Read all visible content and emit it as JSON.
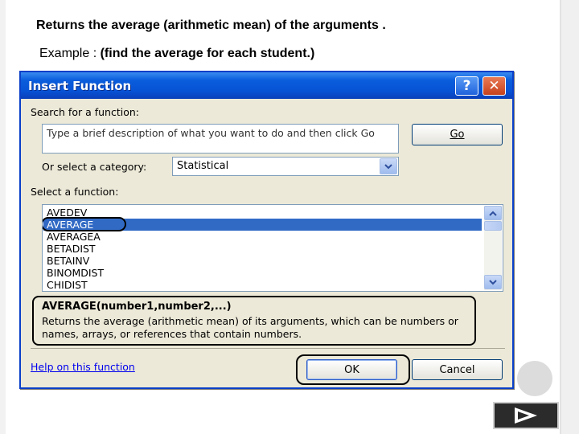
{
  "slide": {
    "title": "Returns the average (arithmetic mean) of the arguments .",
    "example_prefix": "Example : ",
    "example_text": "(find the average for each student.)"
  },
  "dialog": {
    "title": "Insert Function",
    "help_glyph": "?",
    "close_glyph": "✕",
    "search_label": "Search for a function:",
    "search_placeholder": "Type a brief description of what you want to do and then click Go",
    "go_label": "Go",
    "category_label": "Or select a category:",
    "category_value": "Statistical",
    "function_label": "Select a function:",
    "functions": [
      "AVEDEV",
      "AVERAGE",
      "AVERAGEA",
      "BETADIST",
      "BETAINV",
      "BINOMDIST",
      "CHIDIST"
    ],
    "selected_function": "AVERAGE",
    "signature": "AVERAGE(number1,number2,...)",
    "description": "Returns the average (arithmetic mean) of its arguments, which can be numbers or names, arrays, or references that contain numbers.",
    "help_link": "Help on this function",
    "ok_label": "OK",
    "cancel_label": "Cancel"
  },
  "icons": {
    "dropdown": "chevron-down-icon",
    "scroll_up": "scroll-up-icon",
    "scroll_down": "scroll-down-icon",
    "next": "play-arrow-icon"
  },
  "colors": {
    "titlebar": "#0753d6",
    "selection": "#316ac5",
    "dialog_bg": "#ece9d8",
    "link": "#0000ee"
  }
}
